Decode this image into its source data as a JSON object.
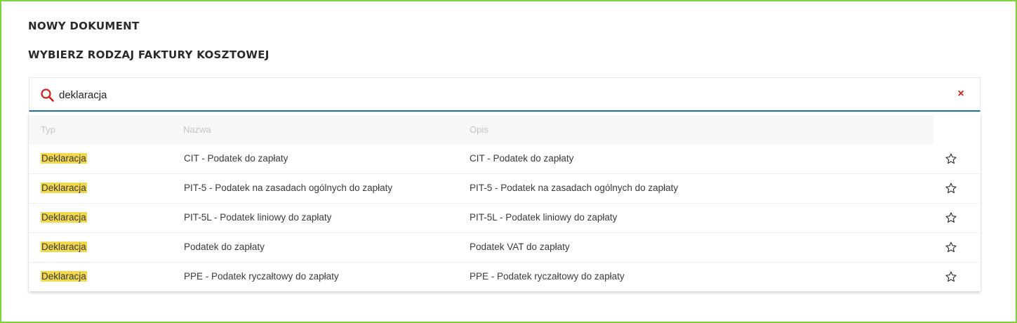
{
  "page": {
    "title": "NOWY DOKUMENT",
    "subtitle": "WYBIERZ RODZAJ FAKTURY KOSZTOWEJ"
  },
  "search": {
    "value": "deklaracja",
    "clear_symbol": "×"
  },
  "colors": {
    "frame_border": "#7ed43a",
    "search_underline": "#1f6fb5",
    "clear_icon": "#d0201a",
    "highlight": "#f2d84c",
    "search_icon": "#d0201a"
  },
  "icons": {
    "search": "search-icon",
    "clear": "close-icon",
    "favorite": "star-outline-icon"
  },
  "table": {
    "headers": {
      "type": "Typ",
      "name": "Nazwa",
      "description": "Opis"
    },
    "rows": [
      {
        "type": "Deklaracja",
        "name": "CIT - Podatek do zapłaty",
        "description": "CIT - Podatek do zapłaty"
      },
      {
        "type": "Deklaracja",
        "name": "PIT-5 - Podatek na zasadach ogólnych do zapłaty",
        "description": "PIT-5 - Podatek na zasadach ogólnych do zapłaty"
      },
      {
        "type": "Deklaracja",
        "name": "PIT-5L - Podatek liniowy do zapłaty",
        "description": "PIT-5L - Podatek liniowy do zapłaty"
      },
      {
        "type": "Deklaracja",
        "name": "Podatek do zapłaty",
        "description": "Podatek VAT do zapłaty"
      },
      {
        "type": "Deklaracja",
        "name": "PPE - Podatek ryczałtowy do zapłaty",
        "description": "PPE - Podatek ryczałtowy do zapłaty"
      }
    ]
  }
}
